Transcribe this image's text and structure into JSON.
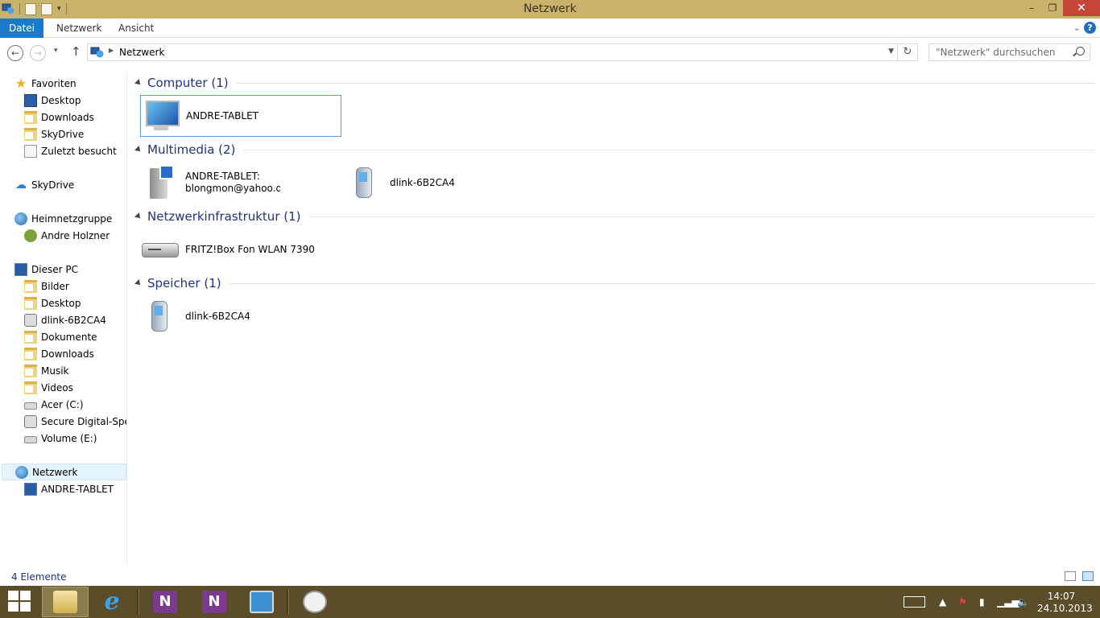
{
  "window": {
    "title": "Netzwerk",
    "controls": {
      "minimize": "–",
      "maximize": "❐",
      "close": "✕"
    }
  },
  "ribbon": {
    "tabs": [
      {
        "label": "Datei"
      },
      {
        "label": "Netzwerk"
      },
      {
        "label": "Ansicht"
      }
    ],
    "help": "?"
  },
  "navigation": {
    "breadcrumb": "Netzwerk",
    "search_placeholder": "\"Netzwerk\" durchsuchen"
  },
  "sidebar": {
    "favorites": {
      "label": "Favoriten",
      "items": [
        {
          "label": "Desktop",
          "icon": "desktop-icon"
        },
        {
          "label": "Downloads",
          "icon": "downloads-folder-icon"
        },
        {
          "label": "SkyDrive",
          "icon": "skydrive-folder-icon"
        },
        {
          "label": "Zuletzt besucht",
          "icon": "recent-places-icon"
        }
      ]
    },
    "skydrive": {
      "label": "SkyDrive"
    },
    "homegroup": {
      "label": "Heimnetzgruppe",
      "items": [
        {
          "label": "Andre Holzner",
          "icon": "user-icon"
        }
      ]
    },
    "this_pc": {
      "label": "Dieser PC",
      "items": [
        {
          "label": "Bilder",
          "icon": "pictures-folder-icon"
        },
        {
          "label": "Desktop",
          "icon": "desktop-folder-icon"
        },
        {
          "label": "dlink-6B2CA4",
          "icon": "network-device-icon"
        },
        {
          "label": "Dokumente",
          "icon": "documents-folder-icon"
        },
        {
          "label": "Downloads",
          "icon": "downloads-folder-icon"
        },
        {
          "label": "Musik",
          "icon": "music-folder-icon"
        },
        {
          "label": "Videos",
          "icon": "videos-folder-icon"
        },
        {
          "label": "Acer (C:)",
          "icon": "windows-drive-icon"
        },
        {
          "label": "Secure Digital-Speicher",
          "icon": "sd-card-icon"
        },
        {
          "label": "Volume (E:)",
          "icon": "drive-icon"
        }
      ]
    },
    "network": {
      "label": "Netzwerk",
      "items": [
        {
          "label": "ANDRE-TABLET",
          "icon": "computer-icon"
        }
      ]
    }
  },
  "groups": [
    {
      "label": "Computer (1)",
      "items": [
        {
          "label": "ANDRE-TABLET",
          "icon": "computer-icon"
        }
      ]
    },
    {
      "label": "Multimedia (2)",
      "items": [
        {
          "label": "ANDRE-TABLET:",
          "label2": "blongmon@yahoo.de:",
          "icon": "media-server-icon"
        },
        {
          "label": "dlink-6B2CA4",
          "icon": "media-device-icon"
        }
      ]
    },
    {
      "label": "Netzwerkinfrastruktur (1)",
      "items": [
        {
          "label": "FRITZ!Box Fon WLAN 7390",
          "icon": "router-icon"
        }
      ]
    },
    {
      "label": "Speicher (1)",
      "items": [
        {
          "label": "dlink-6B2CA4",
          "icon": "storage-device-icon"
        }
      ]
    }
  ],
  "status": {
    "count": "4 Elemente"
  },
  "taskbar": {
    "time": "14:07",
    "date": "24.10.2013",
    "apps": [
      "file-explorer",
      "internet-explorer",
      "onenote-clipper",
      "onenote",
      "control-panel",
      "clock"
    ]
  },
  "colors": {
    "title_bar": "#c9b26a",
    "file_tab": "#1979ca",
    "group_header": "#1e3287",
    "taskbar": "#5b4d2a",
    "selection": "#e5f3fb"
  }
}
